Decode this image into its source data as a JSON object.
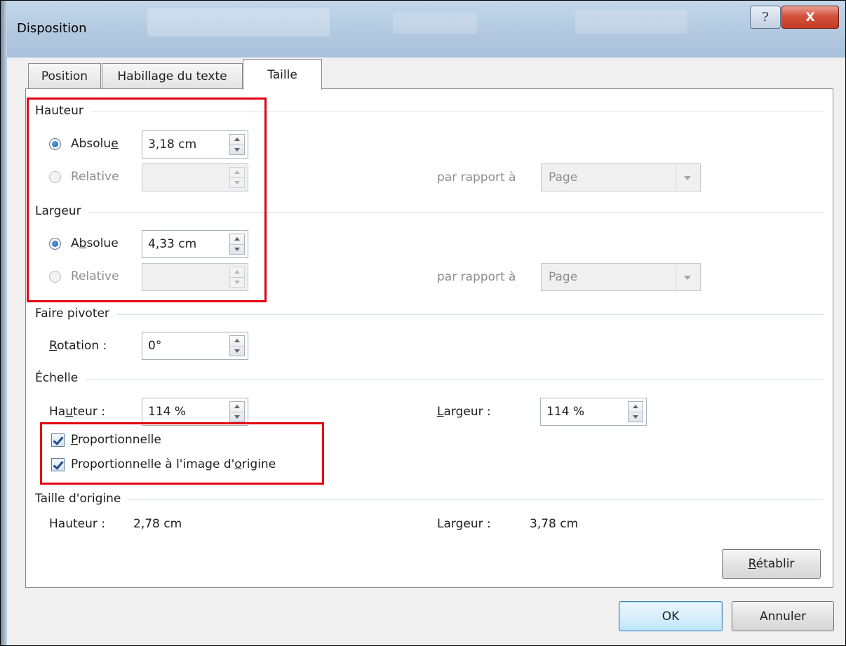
{
  "window": {
    "title": "Disposition",
    "help_label": "?",
    "close_label": "X"
  },
  "tabs": [
    {
      "label": "Position",
      "active": false
    },
    {
      "label": "Habillage du texte",
      "active": false
    },
    {
      "label": "Taille",
      "active": true
    }
  ],
  "hauteur": {
    "title": "Hauteur",
    "absolue": {
      "label_pre": "Absolu",
      "label_mnemonic": "e",
      "label_post": "",
      "value": "3,18 cm",
      "selected": true
    },
    "relative": {
      "label": "Relative",
      "value": "",
      "disabled": true
    },
    "par_rapport_label": "par rapport à",
    "par_rapport_value": "Page"
  },
  "largeur": {
    "title": "Largeur",
    "absolue": {
      "label_pre": "A",
      "label_mnemonic": "b",
      "label_post": "solue",
      "value": "4,33 cm",
      "selected": true
    },
    "relative": {
      "label": "Relative",
      "value": "",
      "disabled": true
    },
    "par_rapport_label": "par rapport à",
    "par_rapport_value": "Page"
  },
  "pivoter": {
    "title": "Faire pivoter",
    "rotation_mnemonic": "R",
    "rotation_rest": "otation :",
    "rotation_value": "0°"
  },
  "echelle": {
    "title": "Échelle",
    "hauteur_pre": "Ha",
    "hauteur_mnemonic": "u",
    "hauteur_post": "teur :",
    "hauteur_value": "114 %",
    "largeur_mnemonic": "L",
    "largeur_post": "argeur :",
    "largeur_value": "114 %",
    "proportionnelle_mnemonic": "P",
    "proportionnelle_rest": "roportionnelle",
    "proportionnelle_checked": true,
    "origine_pre": "Proportionnelle à l'image d'",
    "origine_mnemonic": "o",
    "origine_post": "rigine",
    "origine_checked": true
  },
  "taille_origine": {
    "title": "Taille d'origine",
    "hauteur_label": "Hauteur :",
    "hauteur_value": "2,78 cm",
    "largeur_label": "Largeur :",
    "largeur_value": "3,78 cm"
  },
  "buttons": {
    "retablir_mnemonic": "R",
    "retablir_rest": "établir",
    "ok": "OK",
    "annuler": "Annuler"
  },
  "colors": {
    "highlight": "#e0000f",
    "accent": "#1f5aa7"
  }
}
